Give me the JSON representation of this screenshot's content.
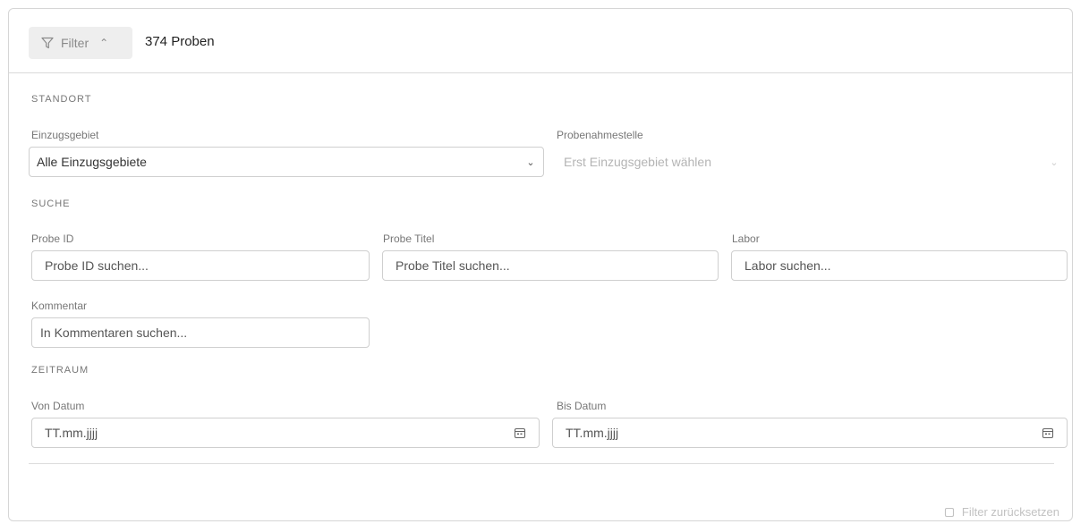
{
  "header": {
    "filter_label": "Filter",
    "count_text": "374 Proben"
  },
  "sections": {
    "standort": "STANDORT",
    "suche": "SUCHE",
    "zeitraum": "ZEITRAUM"
  },
  "standort": {
    "einzugsgebiet_label": "Einzugsgebiet",
    "einzugsgebiet_value": "Alle Einzugsgebiete",
    "probenahmestelle_label": "Probenahmestelle",
    "probenahmestelle_value": "Erst Einzugsgebiet wählen"
  },
  "suche": {
    "probe_id_label": "Probe ID",
    "probe_id_placeholder": "Probe ID suchen...",
    "probe_titel_label": "Probe Titel",
    "probe_titel_placeholder": "Probe Titel suchen...",
    "labor_label": "Labor",
    "labor_placeholder": "Labor suchen...",
    "kommentar_label": "Kommentar",
    "kommentar_placeholder": "In Kommentaren suchen..."
  },
  "zeitraum": {
    "von_label": "Von Datum",
    "von_placeholder": "TT.mm.jjjj",
    "bis_label": "Bis Datum",
    "bis_placeholder": "TT.mm.jjjj"
  },
  "footer": {
    "reset_label": "Filter zurücksetzen"
  },
  "icons": {
    "filter": "filter-icon",
    "chevron_up": "chevron-up-icon",
    "chevron_down": "chevron-down-icon",
    "calendar": "calendar-icon",
    "reset": "reset-icon"
  }
}
